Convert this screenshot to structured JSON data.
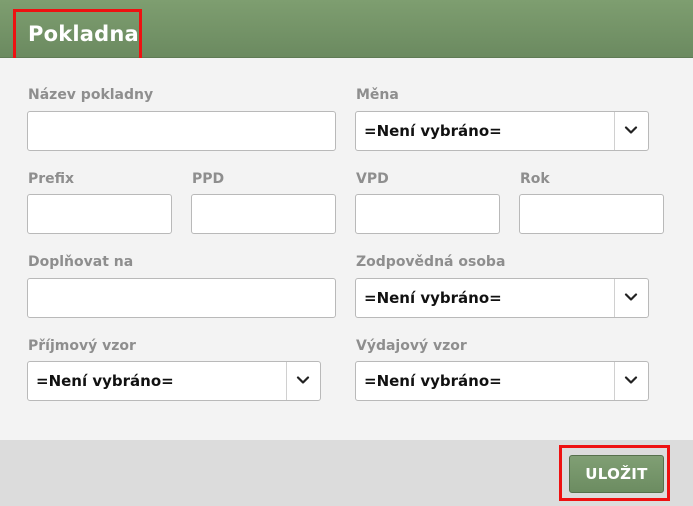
{
  "dialog": {
    "title": "Pokladna"
  },
  "form": {
    "nazev_label": "Název pokladny",
    "nazev_value": "",
    "mena_label": "Měna",
    "mena_value": "=Není vybráno=",
    "prefix_label": "Prefix",
    "prefix_value": "",
    "ppd_label": "PPD",
    "ppd_value": "",
    "vpd_label": "VPD",
    "vpd_value": "",
    "rok_label": "Rok",
    "rok_value": "",
    "doplnovat_label": "Doplňovat na",
    "doplnovat_value": "",
    "zodpovedna_label": "Zodpovědná osoba",
    "zodpovedna_value": "=Není vybráno=",
    "prijmovy_label": "Příjmový vzor",
    "prijmovy_value": "=Není vybráno=",
    "vydajovy_label": "Výdajový vzor",
    "vydajovy_value": "=Není vybráno="
  },
  "footer": {
    "save_label": "ULOŽIT"
  },
  "icons": {
    "select_arrow": "chevron-down-icon"
  },
  "colors": {
    "header": "#6b8a60",
    "save_button": "#759567",
    "highlight": "#ee1111",
    "label": "#8e8e8e"
  }
}
